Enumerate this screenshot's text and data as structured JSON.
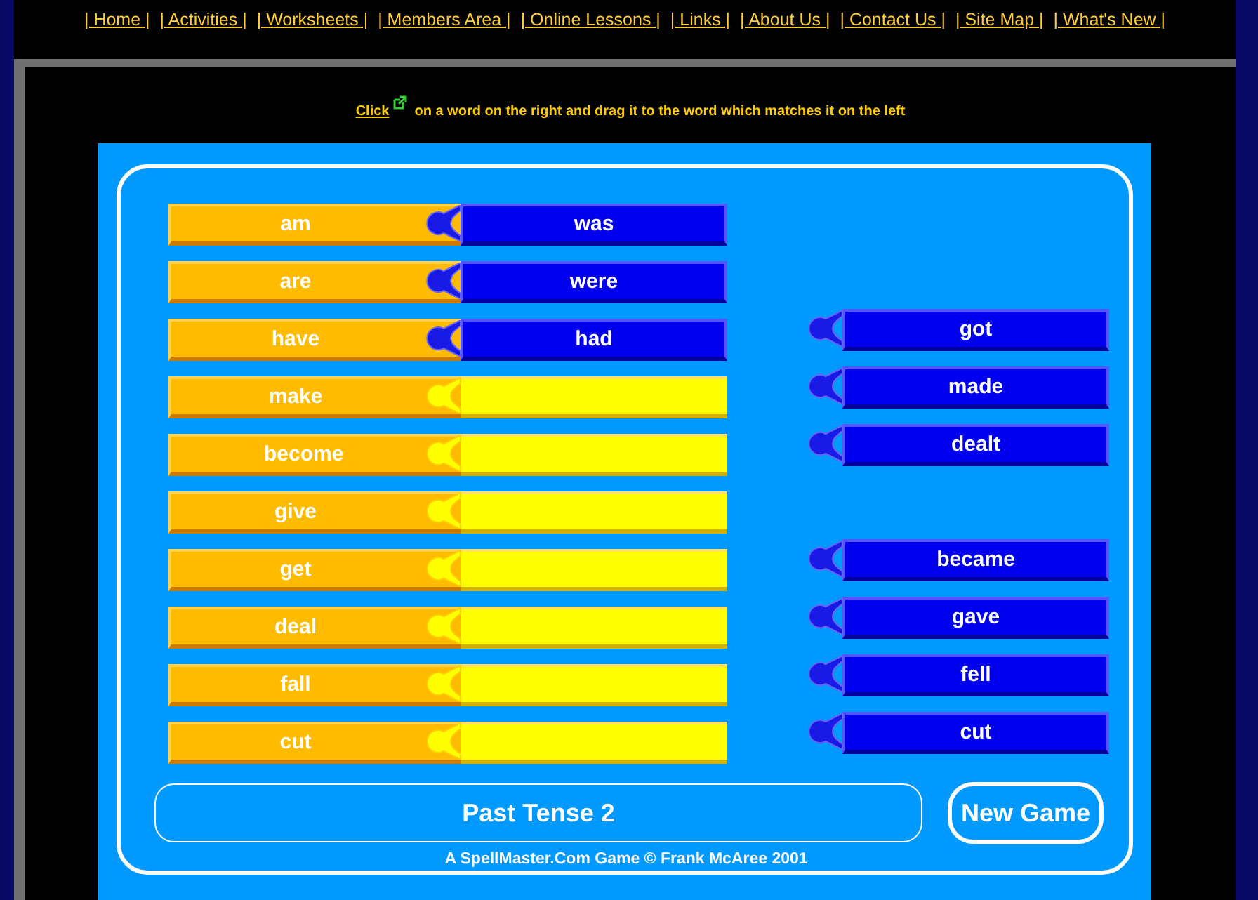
{
  "nav": [
    "| Home |",
    "| Activities |",
    "| Worksheets |",
    "| Members Area |",
    "| Online Lessons |",
    "| Links |",
    "| About Us |",
    "| Contact Us |",
    "| Site Map |",
    "| What's New |"
  ],
  "instruction": {
    "link": "Click",
    "text": "on a word on the right and drag it to the word which matches it on the left"
  },
  "pairs": [
    {
      "word": "am",
      "match": "was"
    },
    {
      "word": "are",
      "match": "were"
    },
    {
      "word": "have",
      "match": "had"
    },
    {
      "word": "make"
    },
    {
      "word": "become"
    },
    {
      "word": "give"
    },
    {
      "word": "get"
    },
    {
      "word": "deal"
    },
    {
      "word": "fall"
    },
    {
      "word": "cut"
    }
  ],
  "tile_groups": [
    [
      "got",
      "made",
      "dealt"
    ],
    [
      "became",
      "gave",
      "fell",
      "cut"
    ]
  ],
  "game_title": "Past Tense 2",
  "new_game_button": "New Game",
  "credit": "A SpellMaster.Com Game © Frank McAree 2001"
}
